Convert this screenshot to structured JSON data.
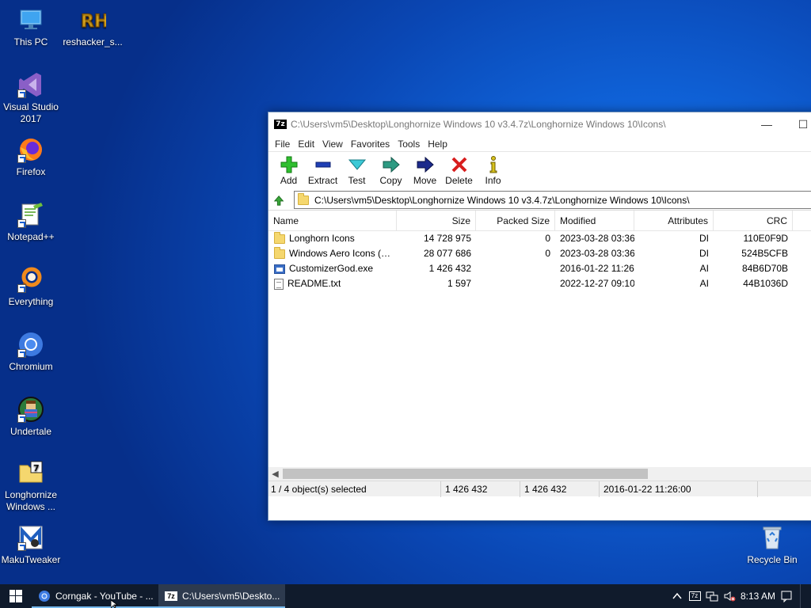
{
  "desktop": {
    "icons": [
      {
        "label": "This PC"
      },
      {
        "label": "reshacker_s..."
      },
      {
        "label": "Visual Studio 2017"
      },
      {
        "label": "Firefox"
      },
      {
        "label": "Notepad++"
      },
      {
        "label": "Everything"
      },
      {
        "label": "Chromium"
      },
      {
        "label": "Undertale"
      },
      {
        "label": "Longhornize Windows ..."
      },
      {
        "label": "MakuTweaker"
      },
      {
        "label": "Recycle Bin"
      }
    ]
  },
  "window": {
    "app_badge": "7z",
    "title": "C:\\Users\\vm5\\Desktop\\Longhornize Windows 10 v3.4.7z\\Longhornize Windows 10\\Icons\\",
    "menu": [
      "File",
      "Edit",
      "View",
      "Favorites",
      "Tools",
      "Help"
    ],
    "toolbar": [
      "Add",
      "Extract",
      "Test",
      "Copy",
      "Move",
      "Delete",
      "Info"
    ],
    "address": "C:\\Users\\vm5\\Desktop\\Longhornize Windows 10 v3.4.7z\\Longhornize Windows 10\\Icons\\",
    "columns": [
      "Name",
      "Size",
      "Packed Size",
      "Modified",
      "Attributes",
      "CRC"
    ],
    "rows": [
      {
        "name": "Longhorn Icons",
        "size": "14 728 975",
        "packed": "0",
        "modified": "2023-03-28 03:36",
        "attributes": "DI",
        "crc": "110E0F9D",
        "icon": "folder-icon"
      },
      {
        "name": "Windows Aero Icons (Hi...",
        "size": "28 077 686",
        "packed": "0",
        "modified": "2023-03-28 03:36",
        "attributes": "DI",
        "crc": "524B5CFB",
        "icon": "folder-icon"
      },
      {
        "name": "CustomizerGod.exe",
        "size": "1 426 432",
        "packed": "",
        "modified": "2016-01-22 11:26",
        "attributes": "AI",
        "crc": "84B6D70B",
        "icon": "exe-icon"
      },
      {
        "name": "README.txt",
        "size": "1 597",
        "packed": "",
        "modified": "2022-12-27 09:10",
        "attributes": "AI",
        "crc": "44B1036D",
        "icon": "text-file-icon"
      }
    ],
    "status": {
      "selected": "1 / 4 object(s) selected",
      "size": "1 426 432",
      "packed": "1 426 432",
      "modified": "2016-01-22 11:26:00"
    }
  },
  "taskbar": {
    "tasks": [
      {
        "label": "Corngak - YouTube - ..."
      },
      {
        "label": "C:\\Users\\vm5\\Deskto..."
      }
    ],
    "tray_badge": "7z",
    "clock": "8:13 AM"
  },
  "colors": {
    "accent": "#76b9ed",
    "taskbar": "#101b2c",
    "desktop": "#0f62d8"
  }
}
